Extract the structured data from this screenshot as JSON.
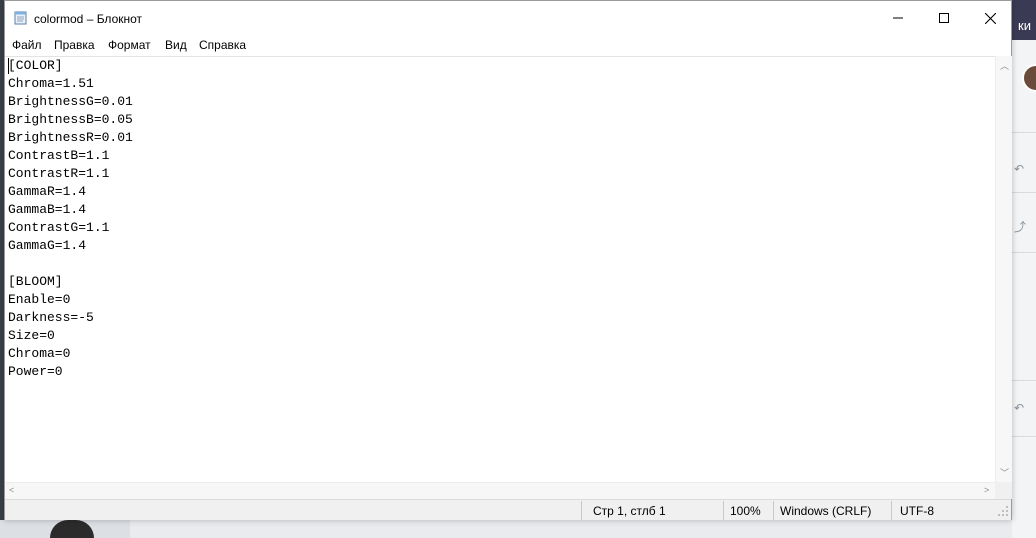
{
  "window": {
    "title": "colormod – Блокнот"
  },
  "menu": [
    "Файл",
    "Правка",
    "Формат",
    "Вид",
    "Справка"
  ],
  "editor": {
    "lines": [
      "[COLOR]",
      "Chroma=1.51",
      "BrightnessG=0.01",
      "BrightnessB=0.05",
      "BrightnessR=0.01",
      "ContrastB=1.1",
      "ContrastR=1.1",
      "GammaR=1.4",
      "GammaB=1.4",
      "ContrastG=1.1",
      "GammaG=1.4",
      "",
      "[BLOOM]",
      "Enable=0",
      "Darkness=-5",
      "Size=0",
      "Chroma=0",
      "Power=0"
    ]
  },
  "statusbar": {
    "position": "Стр 1, стлб 1",
    "zoom": "100%",
    "line_endings": "Windows (CRLF)",
    "encoding": "UTF-8"
  },
  "background": {
    "right_top_text": "ки"
  },
  "icons": {
    "app": "notepad-icon",
    "minimize": "minimize-icon",
    "maximize": "maximize-icon",
    "close": "close-icon"
  }
}
